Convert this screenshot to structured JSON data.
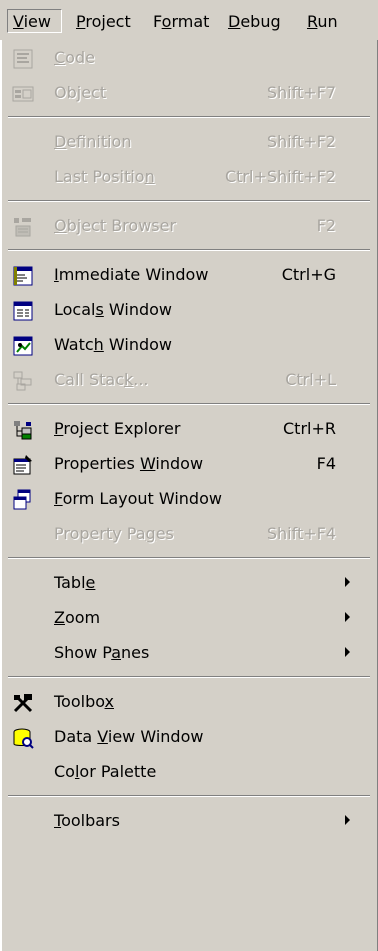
{
  "menubar": [
    {
      "label": "View",
      "mnemonic": "V",
      "active": true
    },
    {
      "label": "Project",
      "mnemonic": "P",
      "active": false
    },
    {
      "label": "Format",
      "mnemonic": "o",
      "active": false
    },
    {
      "label": "Debug",
      "mnemonic": "D",
      "active": false
    },
    {
      "label": "Run",
      "mnemonic": "R",
      "active": false
    }
  ],
  "menu": {
    "items": [
      {
        "type": "item",
        "label": "Code",
        "mnemonic": "C",
        "shortcut": "",
        "icon": "code-icon",
        "disabled": true,
        "submenu": false
      },
      {
        "type": "item",
        "label": "Object",
        "mnemonic": "j",
        "shortcut": "Shift+F7",
        "icon": "object-icon",
        "disabled": true,
        "submenu": false
      },
      {
        "type": "separator"
      },
      {
        "type": "item",
        "label": "Definition",
        "mnemonic": "D",
        "shortcut": "Shift+F2",
        "icon": "",
        "disabled": true,
        "submenu": false
      },
      {
        "type": "item",
        "label": "Last Position",
        "mnemonic": "n",
        "shortcut": "Ctrl+Shift+F2",
        "icon": "",
        "disabled": true,
        "submenu": false
      },
      {
        "type": "separator"
      },
      {
        "type": "item",
        "label": "Object Browser",
        "mnemonic": "O",
        "shortcut": "F2",
        "icon": "object-browser-icon",
        "disabled": true,
        "submenu": false
      },
      {
        "type": "separator"
      },
      {
        "type": "item",
        "label": "Immediate Window",
        "mnemonic": "I",
        "shortcut": "Ctrl+G",
        "icon": "immediate-window-icon",
        "disabled": false,
        "submenu": false
      },
      {
        "type": "item",
        "label": "Locals Window",
        "mnemonic": "s",
        "shortcut": "",
        "icon": "locals-window-icon",
        "disabled": false,
        "submenu": false
      },
      {
        "type": "item",
        "label": "Watch Window",
        "mnemonic": "h",
        "shortcut": "",
        "icon": "watch-window-icon",
        "disabled": false,
        "submenu": false
      },
      {
        "type": "item",
        "label": "Call Stack...",
        "mnemonic": "k",
        "shortcut": "Ctrl+L",
        "icon": "call-stack-icon",
        "disabled": true,
        "submenu": false
      },
      {
        "type": "separator"
      },
      {
        "type": "item",
        "label": "Project Explorer",
        "mnemonic": "P",
        "shortcut": "Ctrl+R",
        "icon": "project-explorer-icon",
        "disabled": false,
        "submenu": false
      },
      {
        "type": "item",
        "label": "Properties Window",
        "mnemonic": "W",
        "shortcut": "F4",
        "icon": "properties-window-icon",
        "disabled": false,
        "submenu": false
      },
      {
        "type": "item",
        "label": "Form Layout Window",
        "mnemonic": "F",
        "shortcut": "",
        "icon": "form-layout-icon",
        "disabled": false,
        "submenu": false
      },
      {
        "type": "item",
        "label": "Property Pages",
        "mnemonic": "g",
        "shortcut": "Shift+F4",
        "icon": "",
        "disabled": true,
        "submenu": false
      },
      {
        "type": "separator"
      },
      {
        "type": "item",
        "label": "Table",
        "mnemonic": "e",
        "shortcut": "",
        "icon": "",
        "disabled": false,
        "submenu": true
      },
      {
        "type": "item",
        "label": "Zoom",
        "mnemonic": "Z",
        "shortcut": "",
        "icon": "",
        "disabled": false,
        "submenu": true
      },
      {
        "type": "item",
        "label": "Show Panes",
        "mnemonic": "a",
        "shortcut": "",
        "icon": "",
        "disabled": false,
        "submenu": true
      },
      {
        "type": "separator"
      },
      {
        "type": "item",
        "label": "Toolbox",
        "mnemonic": "x",
        "shortcut": "",
        "icon": "toolbox-icon",
        "disabled": false,
        "submenu": false
      },
      {
        "type": "item",
        "label": "Data View Window",
        "mnemonic": "V",
        "shortcut": "",
        "icon": "data-view-icon",
        "disabled": false,
        "submenu": false
      },
      {
        "type": "item",
        "label": "Color Palette",
        "mnemonic": "l",
        "shortcut": "",
        "icon": "",
        "disabled": false,
        "submenu": false
      },
      {
        "type": "separator"
      },
      {
        "type": "item",
        "label": "Toolbars",
        "mnemonic": "T",
        "shortcut": "",
        "icon": "",
        "disabled": false,
        "submenu": true
      }
    ]
  }
}
